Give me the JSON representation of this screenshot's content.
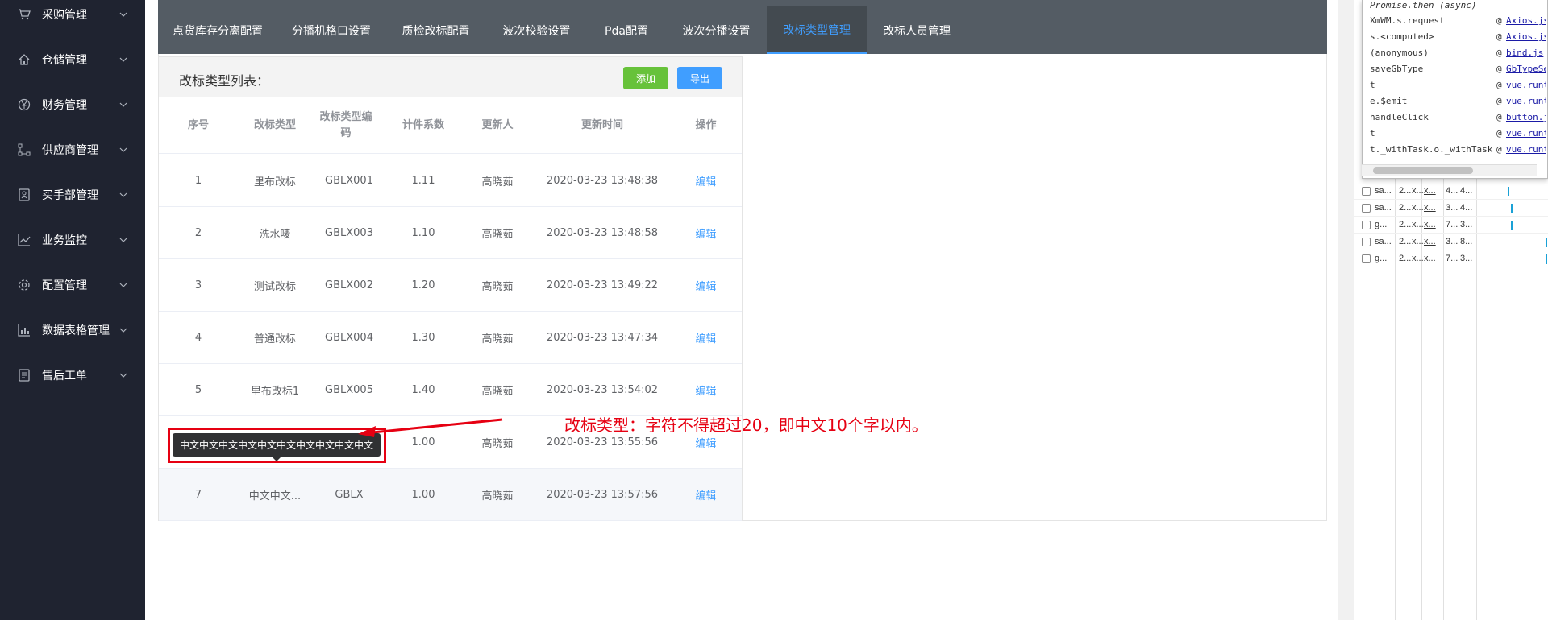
{
  "sidebar": {
    "items": [
      {
        "label": "采购管理",
        "icon": "cart-icon"
      },
      {
        "label": "仓储管理",
        "icon": "home-icon"
      },
      {
        "label": "财务管理",
        "icon": "yen-icon"
      },
      {
        "label": "供应商管理",
        "icon": "network-icon"
      },
      {
        "label": "买手部管理",
        "icon": "badge-icon"
      },
      {
        "label": "业务监控",
        "icon": "trend-icon"
      },
      {
        "label": "配置管理",
        "icon": "gear-icon"
      },
      {
        "label": "数据表格管理",
        "icon": "bar-chart-icon"
      },
      {
        "label": "售后工单",
        "icon": "document-icon"
      }
    ]
  },
  "tabs": [
    {
      "label": "点货库存分离配置"
    },
    {
      "label": "分播机格口设置"
    },
    {
      "label": "质检改标配置"
    },
    {
      "label": "波次校验设置"
    },
    {
      "label": "Pda配置"
    },
    {
      "label": "波次分播设置"
    },
    {
      "label": "改标类型管理",
      "active": true
    },
    {
      "label": "改标人员管理"
    }
  ],
  "panel": {
    "title": "改标类型列表：",
    "add_label": "添加",
    "export_label": "导出"
  },
  "table": {
    "columns": [
      "序号",
      "改标类型",
      "改标类型编码",
      "计件系数",
      "更新人",
      "更新时间",
      "操作"
    ],
    "rows": [
      {
        "no": "1",
        "type": "里布改标",
        "code": "GBLX001",
        "factor": "1.11",
        "updater": "高晓茹",
        "time": "2020-03-23 13:48:38",
        "action": "编辑"
      },
      {
        "no": "2",
        "type": "洗水唛",
        "code": "GBLX003",
        "factor": "1.10",
        "updater": "高晓茹",
        "time": "2020-03-23 13:48:58",
        "action": "编辑"
      },
      {
        "no": "3",
        "type": "测试改标",
        "code": "GBLX002",
        "factor": "1.20",
        "updater": "高晓茹",
        "time": "2020-03-23 13:49:22",
        "action": "编辑"
      },
      {
        "no": "4",
        "type": "普通改标",
        "code": "GBLX004",
        "factor": "1.30",
        "updater": "高晓茹",
        "time": "2020-03-23 13:47:34",
        "action": "编辑"
      },
      {
        "no": "5",
        "type": "里布改标1",
        "code": "GBLX005",
        "factor": "1.40",
        "updater": "高晓茹",
        "time": "2020-03-23 13:54:02",
        "action": "编辑"
      },
      {
        "no": "",
        "type": "",
        "code": "",
        "factor": "1.00",
        "updater": "高晓茹",
        "time": "2020-03-23 13:55:56",
        "action": "编辑"
      },
      {
        "no": "7",
        "type": "中文中文...",
        "code": "GBLX",
        "factor": "1.00",
        "updater": "高晓茹",
        "time": "2020-03-23 13:57:56",
        "action": "编辑"
      }
    ]
  },
  "tooltip": {
    "text": "中文中文中文中文中文中文中文中文中文中文"
  },
  "annotation": {
    "text": "改标类型：字符不得超过20，即中文10个字以内。",
    "color": "#e60012"
  },
  "devtools": {
    "call_stack": [
      {
        "fn": "Promise.then (async)",
        "src": ""
      },
      {
        "fn": "XmWM.s.request",
        "src": "Axios.js"
      },
      {
        "fn": "s.<computed>",
        "src": "Axios.js"
      },
      {
        "fn": "(anonymous)",
        "src": "bind.js"
      },
      {
        "fn": "saveGbType",
        "src": "GbTypeSet"
      },
      {
        "fn": "t",
        "src": "vue.runtime"
      },
      {
        "fn": "e.$emit",
        "src": "vue.runtime"
      },
      {
        "fn": "handleClick",
        "src": "button.js"
      },
      {
        "fn": "t",
        "src": "vue.runtime"
      },
      {
        "fn": "t._withTask.o._withTask",
        "src": "vue.runtime"
      }
    ],
    "network_rows": [
      {
        "name": "sa...",
        "c2": "2...",
        "c3": "x...",
        "c4": "x...",
        "c5": "4...",
        "c6": "4..."
      },
      {
        "name": "sa...",
        "c2": "2...",
        "c3": "x...",
        "c4": "x...",
        "c5": "3...",
        "c6": "4..."
      },
      {
        "name": "g...",
        "c2": "2...",
        "c3": "x...",
        "c4": "x...",
        "c5": "7...",
        "c6": "3..."
      },
      {
        "name": "sa...",
        "c2": "2...",
        "c3": "x...",
        "c4": "x...",
        "c5": "3...",
        "c6": "8..."
      },
      {
        "name": "g...",
        "c2": "2...",
        "c3": "x...",
        "c4": "x...",
        "c5": "7...",
        "c6": "3..."
      }
    ],
    "at_symbol": "@"
  },
  "colors": {
    "sidebar_bg": "#1f2330",
    "tabbar_bg": "#545c64",
    "accent": "#409eff",
    "add_btn": "#67c23a",
    "annotation_red": "#e60012"
  }
}
